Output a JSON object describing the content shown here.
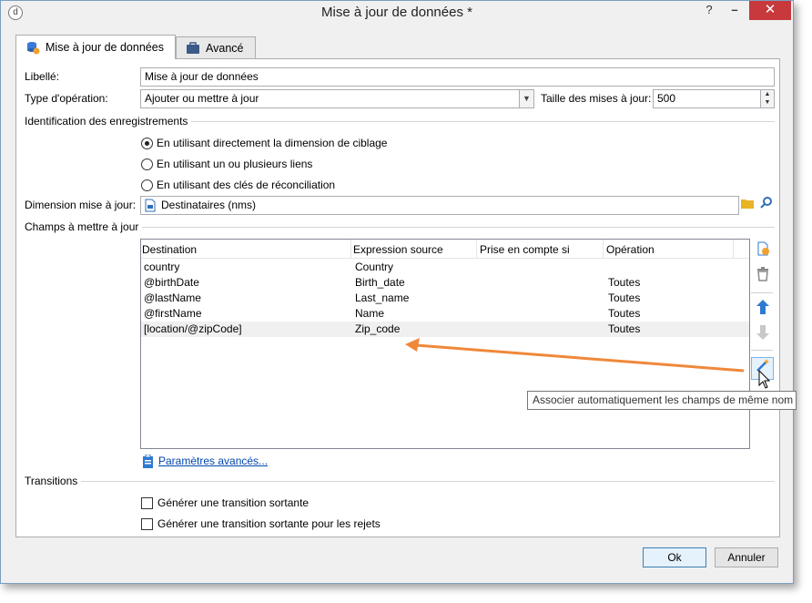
{
  "window": {
    "title": "Mise à jour de données *",
    "help_glyph": "?",
    "minimize_glyph": "–",
    "close_glyph": "✕"
  },
  "tabs": [
    {
      "label": "Mise à jour de données"
    },
    {
      "label": "Avancé"
    }
  ],
  "form": {
    "libelle_label": "Libellé:",
    "libelle_value": "Mise à jour de données",
    "type_label": "Type d'opération:",
    "type_value": "Ajouter ou mettre à jour",
    "taille_label": "Taille des mises à jour:",
    "taille_value": "500",
    "identification_title": "Identification des enregistrements",
    "radios": [
      {
        "label": "En utilisant directement la dimension de ciblage",
        "checked": true
      },
      {
        "label": "En utilisant un ou plusieurs liens",
        "checked": false
      },
      {
        "label": "En utilisant des clés de réconciliation",
        "checked": false
      }
    ],
    "dimension_label": "Dimension mise à jour:",
    "dimension_value": "Destinataires (nms)",
    "champs_title": "Champs à mettre à jour"
  },
  "grid": {
    "columns": [
      "Destination",
      "Expression source",
      "Prise en compte si",
      "Opération"
    ],
    "rows": [
      {
        "destination": "country",
        "source": "Country",
        "condition": "",
        "operation": ""
      },
      {
        "destination": "@birthDate",
        "source": "Birth_date",
        "condition": "",
        "operation": "Toutes"
      },
      {
        "destination": "@lastName",
        "source": "Last_name",
        "condition": "",
        "operation": "Toutes"
      },
      {
        "destination": "@firstName",
        "source": "Name",
        "condition": "",
        "operation": "Toutes"
      },
      {
        "destination": "[location/@zipCode]",
        "source": "Zip_code",
        "condition": "",
        "operation": "Toutes"
      }
    ]
  },
  "tooltip": "Associer automatiquement les champs de même nom",
  "advanced_link": "Paramètres avancés...",
  "transitions": {
    "title": "Transitions",
    "options": [
      {
        "label": "Générer une transition sortante",
        "checked": false
      },
      {
        "label": "Générer une transition sortante pour les rejets",
        "checked": false
      }
    ]
  },
  "buttons": {
    "ok": "Ok",
    "cancel": "Annuler"
  },
  "colors": {
    "accent_arrow": "#f0883a",
    "link": "#0046ad",
    "close_button": "#c7393b",
    "icon_blue": "#2f7ad1"
  }
}
